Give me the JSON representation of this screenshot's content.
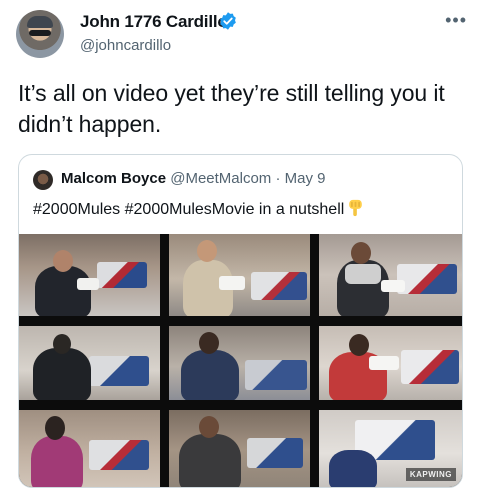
{
  "tweet": {
    "author": {
      "display_name": "John 1776 Cardillo",
      "handle": "@johncardillo",
      "verified": true,
      "avatar_icon": "user-avatar"
    },
    "more_icon": "more-horizontal-icon",
    "text": "It’s all on video yet they’re still telling you it didn’t happen."
  },
  "quote": {
    "author": {
      "display_name": "Malcom Boyce",
      "handle": "@MeetMalcom",
      "separator": "·",
      "date": "May 9"
    },
    "text": "#2000Mules #2000MulesMovie in a nutshell",
    "emoji": "pointing-down-hand-icon",
    "media": {
      "type": "video-grid",
      "watermark": "KAPWING"
    }
  },
  "colors": {
    "text_primary": "#0f1419",
    "text_secondary": "#536471",
    "verified": "#1d9bf0",
    "border": "#cfd9de"
  }
}
